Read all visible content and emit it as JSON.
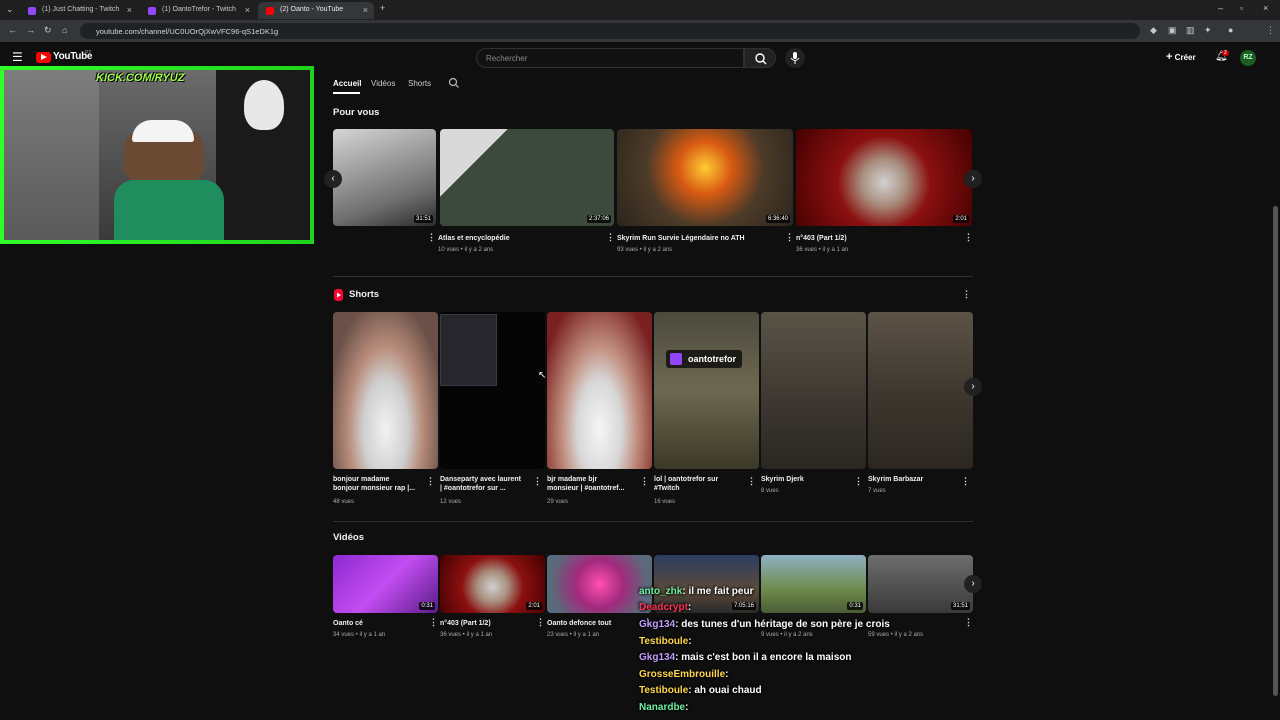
{
  "browser": {
    "tabs": [
      {
        "label": "(1) Just Chatting - Twitch",
        "color": "#9146ff"
      },
      {
        "label": "(1) OantoTrefor - Twitch",
        "color": "#9146ff"
      },
      {
        "label": "(2) Oanto - YouTube",
        "color": "#ff0000"
      }
    ],
    "url": "youtube.com/channel/UC0UOrQjXwVFC96-qS1eDK1g"
  },
  "youtube": {
    "logo": "YouTube",
    "logo_sup": "PT",
    "search_placeholder": "Rechercher",
    "create_label": "Créer",
    "notif_count": "2",
    "avatar": "RZ"
  },
  "channel_tabs": [
    "Accueil",
    "Vidéos",
    "Shorts"
  ],
  "overlay": {
    "kick_label": "KICK.COM/RYUZ"
  },
  "sections": {
    "pour_vous": "Pour vous",
    "shorts": "Shorts",
    "videos": "Vidéos"
  },
  "pour_vous_items": [
    {
      "title": "",
      "meta": "",
      "duration": "31:51"
    },
    {
      "title": "Atlas et encyclopédie",
      "meta": "10 vues • il y a 2 ans",
      "duration": "2:37:06"
    },
    {
      "title": "Skyrim Run Survie Légendaire no ATH",
      "meta": "93 vues • il y a 2 ans",
      "duration": "6:36:40"
    },
    {
      "title": "n°403 (Part 1/2)",
      "meta": "36 vues • il y a 1 an",
      "duration": "2:01"
    }
  ],
  "shorts_items": [
    {
      "title1": "bonjour madame",
      "title2": "bonjour monsieur rap |...",
      "meta": "48 vues"
    },
    {
      "title1": "Danseparty avec laurent",
      "title2": "| #oantotrefor sur ...",
      "meta": "12 vues"
    },
    {
      "title1": "bjr madame bjr",
      "title2": "monsieur | #oantotref...",
      "meta": "29 vues"
    },
    {
      "title1": "lol | oantotrefor sur",
      "title2": "#Twitch",
      "meta": "16 vues"
    },
    {
      "title1": "Skyrim Djerk",
      "title2": "",
      "meta": "8 vues"
    },
    {
      "title1": "Skyrim Barbazar",
      "title2": "",
      "meta": "7 vues"
    }
  ],
  "shorts_badge": "oantotrefor",
  "videos_items": [
    {
      "title": "Oanto cé",
      "meta": "34 vues • il y a 1 an",
      "duration": "0:31"
    },
    {
      "title": "n°403 (Part 1/2)",
      "meta": "36 vues • il y a 1 an",
      "duration": "2:01"
    },
    {
      "title": "Oanto defonce tout",
      "meta": "23 vues • il y a 1 an",
      "duration": ""
    },
    {
      "title": "",
      "meta": "",
      "duration": "7:05:16"
    },
    {
      "title": "",
      "meta": "9 vues • il y a 2 ans",
      "duration": "0:31"
    },
    {
      "title": "",
      "meta": "59 vues • il y a 2 ans",
      "duration": "31:51"
    }
  ],
  "chat": [
    {
      "user": "anto_zhk",
      "msg": ": il me fait peur"
    },
    {
      "user": "Deadcrypt",
      "msg": ":"
    },
    {
      "user": "Gkg134",
      "msg": ": des tunes d'un héritage de son père je crois"
    },
    {
      "user": "Testiboule",
      "msg": ":"
    },
    {
      "user": "Gkg134",
      "msg": ": mais c'est bon il a encore la maison"
    },
    {
      "user": "GrosseEmbrouille",
      "msg": ":"
    },
    {
      "user": "Testiboule",
      "msg": ": ah ouai chaud"
    },
    {
      "user": "Nanardbe",
      "msg": ":"
    }
  ]
}
